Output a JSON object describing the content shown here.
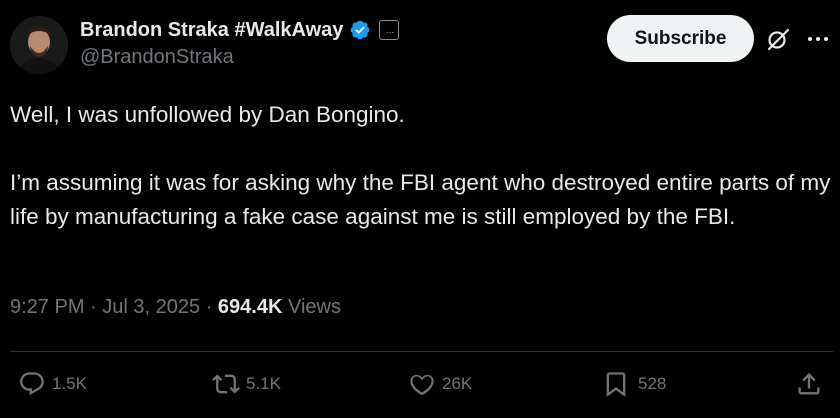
{
  "author": {
    "display_name": "Brandon Straka #WalkAway",
    "handle": "@BrandonStraka",
    "label_badge": "…"
  },
  "subscribe_label": "Subscribe",
  "tweet": {
    "paragraphs": [
      "Well, I was unfollowed by Dan Bongino.",
      "I’m assuming it was for asking why the FBI agent who destroyed entire parts of my life by manufacturing a fake case against me is still employed by the FBI."
    ]
  },
  "meta": {
    "time": "9:27 PM",
    "date": "Jul 3, 2025",
    "views_count": "694.4K",
    "views_label": "Views"
  },
  "actions": {
    "replies": "1.5K",
    "reposts": "5.1K",
    "likes": "26K",
    "bookmarks": "528"
  },
  "colors": {
    "background": "#000000",
    "text": "#e7e9ea",
    "secondary_text": "#71767b",
    "verified_blue": "#1d9bf0",
    "button_bg": "#eff3f4"
  },
  "icons": [
    "avatar",
    "verified-badge-icon",
    "label-badge-icon",
    "grok-icon",
    "more-icon",
    "reply-icon",
    "repost-icon",
    "like-icon",
    "bookmark-icon",
    "share-icon"
  ]
}
